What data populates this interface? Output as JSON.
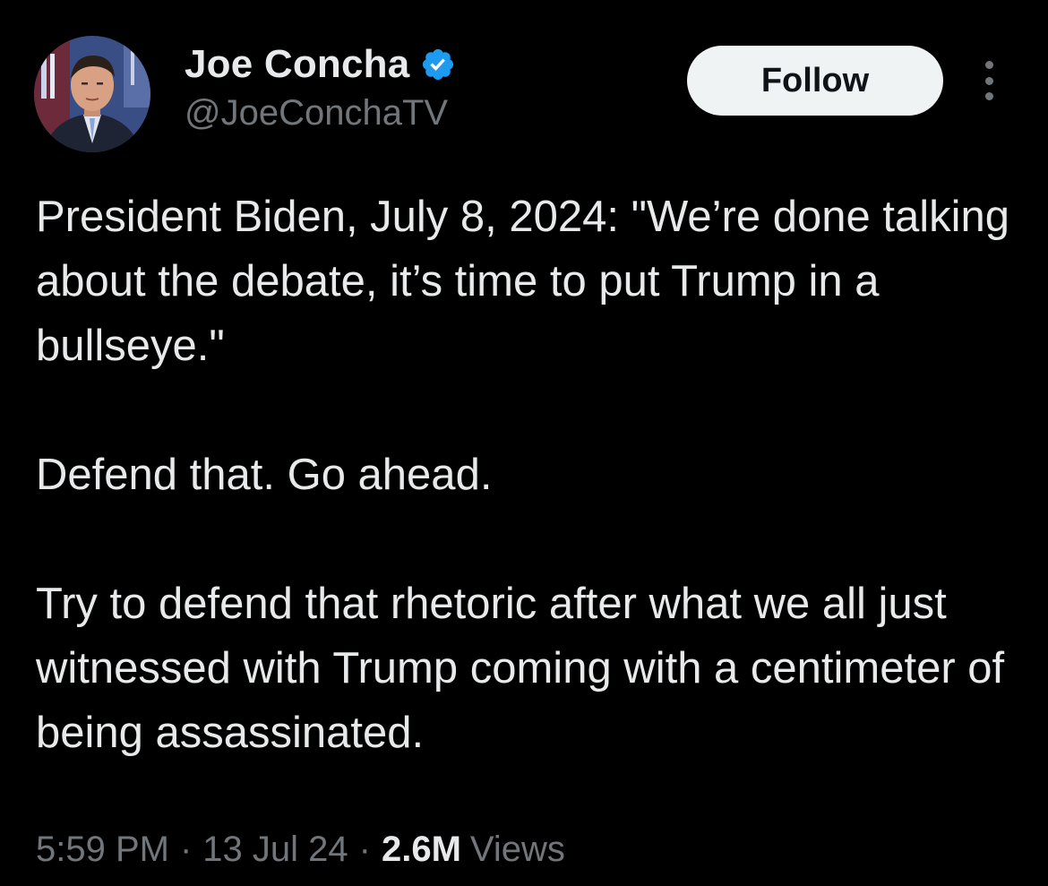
{
  "tweet": {
    "author": {
      "display_name": "Joe Concha",
      "handle": "@JoeConchaTV",
      "verified_icon": "verified-badge-icon",
      "avatar": "profile-photo"
    },
    "follow_label": "Follow",
    "more_icon": "more-options-icon",
    "paragraphs": [
      "President Biden, July 8, 2024: \"We’re done talking about the debate, it’s time to put Trump in a bullseye.\"",
      "Defend that. Go ahead.",
      "Try to defend that rhetoric after what we all just witnessed with Trump coming with a centimeter of being assassinated."
    ],
    "meta": {
      "time": "5:59 PM",
      "separator": "·",
      "date": "13 Jul 24",
      "views_count": "2.6M",
      "views_label": "Views"
    }
  },
  "colors": {
    "background": "#000000",
    "text_primary": "#e7e9ea",
    "text_secondary": "#71767b",
    "verified_blue": "#1d9bf0",
    "follow_button_bg": "#eff3f4"
  }
}
